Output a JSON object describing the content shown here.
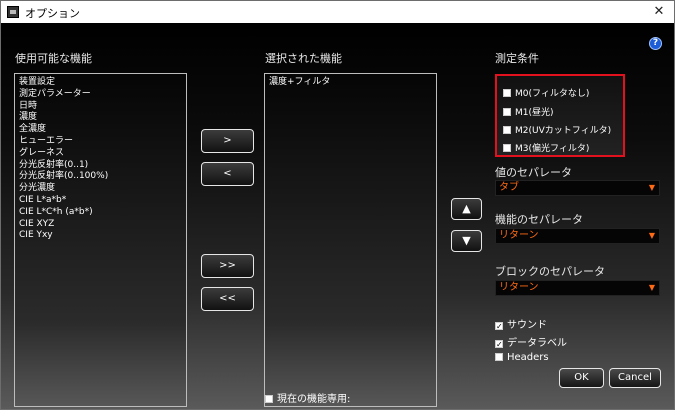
{
  "window": {
    "title": "オプション",
    "close_glyph": "✕"
  },
  "available": {
    "label": "使用可能な機能",
    "items": [
      "装置設定",
      "測定パラメーター",
      "日時",
      "濃度",
      "全濃度",
      "ヒューエラー",
      "グレーネス",
      "分光反射率(0..1)",
      "分光反射率(0..100%)",
      "分光濃度",
      "CIE L*a*b*",
      "CIE L*C*h (a*b*)",
      "CIE XYZ",
      "CIE Yxy"
    ]
  },
  "selected": {
    "label": "選択された機能",
    "items": [
      "濃度+フィルタ"
    ]
  },
  "move_buttons": {
    "add": ">",
    "remove": "<",
    "add_all": ">>",
    "remove_all": "<<"
  },
  "order_buttons": {
    "up": "▲",
    "down": "▼"
  },
  "conditions": {
    "label": "測定条件",
    "items": [
      {
        "label": "M0(フィルタなし)",
        "checked": false
      },
      {
        "label": "M1(昼光)",
        "checked": false
      },
      {
        "label": "M2(UVカットフィルタ)",
        "checked": false
      },
      {
        "label": "M3(偏光フィルタ)",
        "checked": false
      }
    ]
  },
  "value_separator": {
    "label": "値のセパレータ",
    "value": "タブ"
  },
  "function_separator": {
    "label": "機能のセパレータ",
    "value": "リターン"
  },
  "block_separator": {
    "label": "ブロックのセパレータ",
    "value": "リターン"
  },
  "options": {
    "sound": {
      "label": "サウンド",
      "checked": true
    },
    "data_label": {
      "label": "データラベル",
      "checked": true
    },
    "headers": {
      "label": "Headers",
      "checked": false
    }
  },
  "current_only": {
    "label": "現在の機能専用:",
    "checked": false
  },
  "buttons": {
    "ok": "OK",
    "cancel": "Cancel"
  },
  "help": {
    "glyph": "?"
  },
  "colors": {
    "accent": "#e3101d",
    "select_text": "#ff6a14",
    "help": "#1c5cd6"
  }
}
